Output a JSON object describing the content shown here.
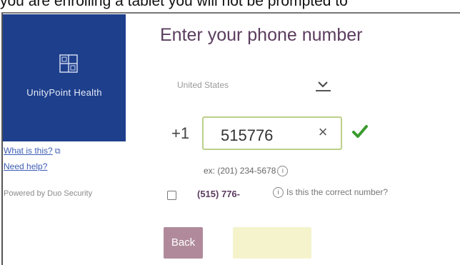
{
  "caption": "you are enrolling a tablet you will not be prompted to",
  "sidebar": {
    "brand_name": "UnityPoint Health",
    "what_is_this": "What is this?",
    "need_help": "Need help?",
    "powered_by": "Powered by Duo Security"
  },
  "main": {
    "heading": "Enter your phone number",
    "country": "United States",
    "dial_prefix": "+1",
    "phone_value": "515776",
    "clear_glyph": "×",
    "example": "ex: (201) 234-5678",
    "confirm_number": "(515) 776-",
    "confirm_question": "Is this the correct number?",
    "back_label": "Back",
    "info_glyph": "i"
  },
  "colors": {
    "brand_blue": "#1e3f8c",
    "heading_purple": "#5b3d5f",
    "valid_green": "#3a9a2e",
    "back_button": "#b08a9b",
    "continue_button": "#f4f3cc"
  },
  "icons": {
    "logo": "unitypoint-logo-icon",
    "external": "external-link-icon",
    "dropdown": "chevron-down-icon",
    "clear": "clear-icon",
    "valid": "checkmark-icon",
    "info": "info-icon"
  }
}
